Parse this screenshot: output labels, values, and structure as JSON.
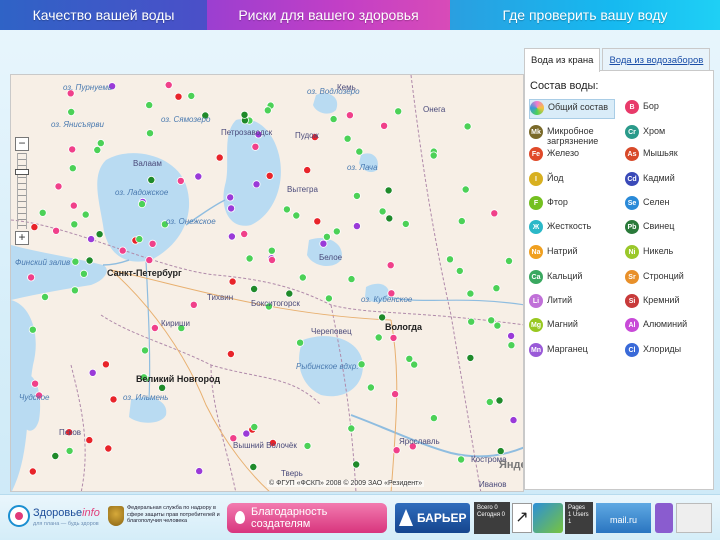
{
  "topnav": {
    "tab1": "Качество вашей воды",
    "tab2": "Риски для вашего здоровья",
    "tab3": "Где проверить вашу воду"
  },
  "panel": {
    "tab_active": "Вода из крана",
    "tab_inactive": "Вода из водозаборов",
    "title": "Состав воды:",
    "items_left": [
      {
        "code": "",
        "label": "Общий состав",
        "color": "#f27ad0",
        "selected": true
      },
      {
        "code": "Mk",
        "label": "Микробное загрязнение",
        "color": "#7a6a2a"
      },
      {
        "code": "Fe",
        "label": "Железо",
        "color": "#e04a2a"
      },
      {
        "code": "I",
        "label": "Йод",
        "color": "#d8b020"
      },
      {
        "code": "F",
        "label": "Фтор",
        "color": "#74c020"
      },
      {
        "code": "Ж",
        "label": "Жесткость",
        "color": "#2bb8c8"
      },
      {
        "code": "Na",
        "label": "Натрий",
        "color": "#f0a020"
      },
      {
        "code": "Ca",
        "label": "Кальций",
        "color": "#3aa860"
      },
      {
        "code": "Li",
        "label": "Литий",
        "color": "#c070d8"
      },
      {
        "code": "Mg",
        "label": "Магний",
        "color": "#98c820"
      },
      {
        "code": "Mn",
        "label": "Марганец",
        "color": "#9a5ad8"
      }
    ],
    "items_right": [
      {
        "code": "B",
        "label": "Бор",
        "color": "#e83a6a"
      },
      {
        "code": "Cr",
        "label": "Хром",
        "color": "#2a9a8a"
      },
      {
        "code": "As",
        "label": "Мышьяк",
        "color": "#d84a2a"
      },
      {
        "code": "Cd",
        "label": "Кадмий",
        "color": "#3a4ab8"
      },
      {
        "code": "Se",
        "label": "Селен",
        "color": "#2a8ad8"
      },
      {
        "code": "Pb",
        "label": "Свинец",
        "color": "#2a7a3a"
      },
      {
        "code": "Ni",
        "label": "Никель",
        "color": "#9ac82a"
      },
      {
        "code": "Sr",
        "label": "Стронций",
        "color": "#e8902a"
      },
      {
        "code": "Si",
        "label": "Кремний",
        "color": "#c83a3a"
      },
      {
        "code": "Al",
        "label": "Алюминий",
        "color": "#c84ad8"
      },
      {
        "code": "Cl",
        "label": "Хлориды",
        "color": "#3a6ad8"
      }
    ]
  },
  "map": {
    "labels": [
      {
        "t": "оз. Пурнуемь"
      },
      {
        "t": "оз. Янисъярви"
      },
      {
        "t": "оз. Сямозеро"
      },
      {
        "t": "Петрозаводск"
      },
      {
        "t": "оз. Водлозеро"
      },
      {
        "t": "оз. Лача"
      },
      {
        "t": "Валаам"
      },
      {
        "t": "оз. Ладожское"
      },
      {
        "t": "оз. Онежское"
      },
      {
        "t": "Санкт-Петербург"
      },
      {
        "t": "Финский залив"
      },
      {
        "t": "Белое"
      },
      {
        "t": "оз. Кубенское"
      },
      {
        "t": "Вологда"
      },
      {
        "t": "Великий Новгород"
      },
      {
        "t": "оз. Ильмень"
      },
      {
        "t": "Псков"
      },
      {
        "t": "Рыбинское вдхр."
      },
      {
        "t": "Ярославль"
      },
      {
        "t": "Вышний Волочёк"
      },
      {
        "t": "Тверь"
      },
      {
        "t": "Кострома"
      },
      {
        "t": "Иванов"
      },
      {
        "t": "Тихвин"
      },
      {
        "t": "Чудское"
      },
      {
        "t": "Кириши"
      },
      {
        "t": "Бокситогорск"
      },
      {
        "t": "Череповец"
      },
      {
        "t": "Кемь"
      },
      {
        "t": "Пудож"
      },
      {
        "t": "Онега"
      },
      {
        "t": "Вытегра"
      }
    ],
    "copyright": "© ФГУП «ФСКП» 2008 © 2009 ЗАО «Резидент»",
    "yandex": "Яндекс"
  },
  "zoom": {
    "plus": "+",
    "minus": "−"
  },
  "footer": {
    "brand1": "Здоровье",
    "brand2": "info",
    "brand_sub": "для плана — будь здоров",
    "rospotreb": "Федеральная служба по надзору в сфере защиты прав потребителей и благополучия человека",
    "thanks": "Благодарность создателям",
    "barrier": "БАРЬЕР",
    "counter1": "Всего 0 Сегодня 0",
    "counter2": "Pages 1 Users 1",
    "mail": "mail.ru"
  },
  "dots": {
    "colors": {
      "green": "#4cd157",
      "pink": "#f0408a",
      "red": "#e8242a",
      "purple": "#9a3ad8",
      "darkgreen": "#1f8a2a",
      "blue": "#3a7ad8"
    }
  }
}
